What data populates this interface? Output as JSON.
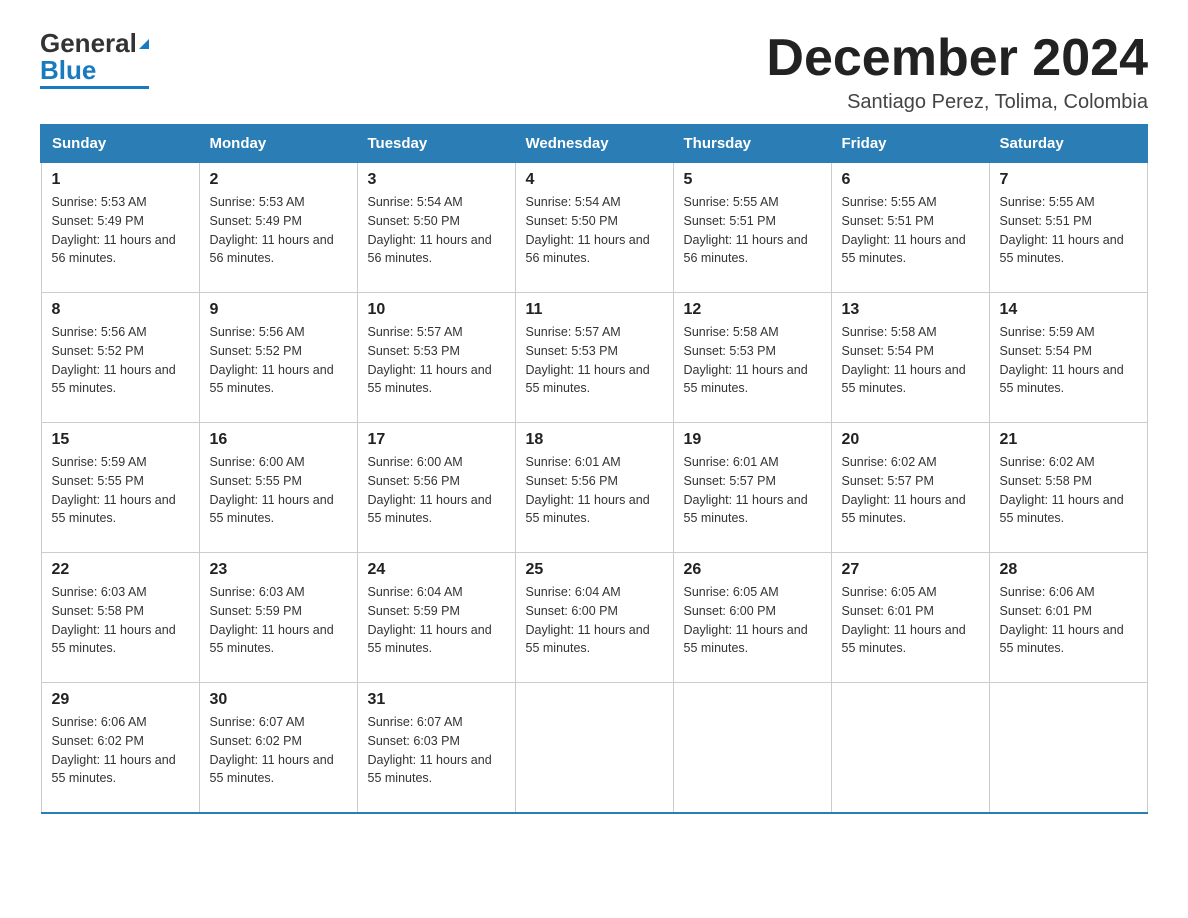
{
  "header": {
    "logo_general": "General",
    "logo_blue": "Blue",
    "month_title": "December 2024",
    "subtitle": "Santiago Perez, Tolima, Colombia"
  },
  "days_of_week": [
    "Sunday",
    "Monday",
    "Tuesday",
    "Wednesday",
    "Thursday",
    "Friday",
    "Saturday"
  ],
  "weeks": [
    [
      {
        "day": "1",
        "sunrise": "Sunrise: 5:53 AM",
        "sunset": "Sunset: 5:49 PM",
        "daylight": "Daylight: 11 hours and 56 minutes."
      },
      {
        "day": "2",
        "sunrise": "Sunrise: 5:53 AM",
        "sunset": "Sunset: 5:49 PM",
        "daylight": "Daylight: 11 hours and 56 minutes."
      },
      {
        "day": "3",
        "sunrise": "Sunrise: 5:54 AM",
        "sunset": "Sunset: 5:50 PM",
        "daylight": "Daylight: 11 hours and 56 minutes."
      },
      {
        "day": "4",
        "sunrise": "Sunrise: 5:54 AM",
        "sunset": "Sunset: 5:50 PM",
        "daylight": "Daylight: 11 hours and 56 minutes."
      },
      {
        "day": "5",
        "sunrise": "Sunrise: 5:55 AM",
        "sunset": "Sunset: 5:51 PM",
        "daylight": "Daylight: 11 hours and 56 minutes."
      },
      {
        "day": "6",
        "sunrise": "Sunrise: 5:55 AM",
        "sunset": "Sunset: 5:51 PM",
        "daylight": "Daylight: 11 hours and 55 minutes."
      },
      {
        "day": "7",
        "sunrise": "Sunrise: 5:55 AM",
        "sunset": "Sunset: 5:51 PM",
        "daylight": "Daylight: 11 hours and 55 minutes."
      }
    ],
    [
      {
        "day": "8",
        "sunrise": "Sunrise: 5:56 AM",
        "sunset": "Sunset: 5:52 PM",
        "daylight": "Daylight: 11 hours and 55 minutes."
      },
      {
        "day": "9",
        "sunrise": "Sunrise: 5:56 AM",
        "sunset": "Sunset: 5:52 PM",
        "daylight": "Daylight: 11 hours and 55 minutes."
      },
      {
        "day": "10",
        "sunrise": "Sunrise: 5:57 AM",
        "sunset": "Sunset: 5:53 PM",
        "daylight": "Daylight: 11 hours and 55 minutes."
      },
      {
        "day": "11",
        "sunrise": "Sunrise: 5:57 AM",
        "sunset": "Sunset: 5:53 PM",
        "daylight": "Daylight: 11 hours and 55 minutes."
      },
      {
        "day": "12",
        "sunrise": "Sunrise: 5:58 AM",
        "sunset": "Sunset: 5:53 PM",
        "daylight": "Daylight: 11 hours and 55 minutes."
      },
      {
        "day": "13",
        "sunrise": "Sunrise: 5:58 AM",
        "sunset": "Sunset: 5:54 PM",
        "daylight": "Daylight: 11 hours and 55 minutes."
      },
      {
        "day": "14",
        "sunrise": "Sunrise: 5:59 AM",
        "sunset": "Sunset: 5:54 PM",
        "daylight": "Daylight: 11 hours and 55 minutes."
      }
    ],
    [
      {
        "day": "15",
        "sunrise": "Sunrise: 5:59 AM",
        "sunset": "Sunset: 5:55 PM",
        "daylight": "Daylight: 11 hours and 55 minutes."
      },
      {
        "day": "16",
        "sunrise": "Sunrise: 6:00 AM",
        "sunset": "Sunset: 5:55 PM",
        "daylight": "Daylight: 11 hours and 55 minutes."
      },
      {
        "day": "17",
        "sunrise": "Sunrise: 6:00 AM",
        "sunset": "Sunset: 5:56 PM",
        "daylight": "Daylight: 11 hours and 55 minutes."
      },
      {
        "day": "18",
        "sunrise": "Sunrise: 6:01 AM",
        "sunset": "Sunset: 5:56 PM",
        "daylight": "Daylight: 11 hours and 55 minutes."
      },
      {
        "day": "19",
        "sunrise": "Sunrise: 6:01 AM",
        "sunset": "Sunset: 5:57 PM",
        "daylight": "Daylight: 11 hours and 55 minutes."
      },
      {
        "day": "20",
        "sunrise": "Sunrise: 6:02 AM",
        "sunset": "Sunset: 5:57 PM",
        "daylight": "Daylight: 11 hours and 55 minutes."
      },
      {
        "day": "21",
        "sunrise": "Sunrise: 6:02 AM",
        "sunset": "Sunset: 5:58 PM",
        "daylight": "Daylight: 11 hours and 55 minutes."
      }
    ],
    [
      {
        "day": "22",
        "sunrise": "Sunrise: 6:03 AM",
        "sunset": "Sunset: 5:58 PM",
        "daylight": "Daylight: 11 hours and 55 minutes."
      },
      {
        "day": "23",
        "sunrise": "Sunrise: 6:03 AM",
        "sunset": "Sunset: 5:59 PM",
        "daylight": "Daylight: 11 hours and 55 minutes."
      },
      {
        "day": "24",
        "sunrise": "Sunrise: 6:04 AM",
        "sunset": "Sunset: 5:59 PM",
        "daylight": "Daylight: 11 hours and 55 minutes."
      },
      {
        "day": "25",
        "sunrise": "Sunrise: 6:04 AM",
        "sunset": "Sunset: 6:00 PM",
        "daylight": "Daylight: 11 hours and 55 minutes."
      },
      {
        "day": "26",
        "sunrise": "Sunrise: 6:05 AM",
        "sunset": "Sunset: 6:00 PM",
        "daylight": "Daylight: 11 hours and 55 minutes."
      },
      {
        "day": "27",
        "sunrise": "Sunrise: 6:05 AM",
        "sunset": "Sunset: 6:01 PM",
        "daylight": "Daylight: 11 hours and 55 minutes."
      },
      {
        "day": "28",
        "sunrise": "Sunrise: 6:06 AM",
        "sunset": "Sunset: 6:01 PM",
        "daylight": "Daylight: 11 hours and 55 minutes."
      }
    ],
    [
      {
        "day": "29",
        "sunrise": "Sunrise: 6:06 AM",
        "sunset": "Sunset: 6:02 PM",
        "daylight": "Daylight: 11 hours and 55 minutes."
      },
      {
        "day": "30",
        "sunrise": "Sunrise: 6:07 AM",
        "sunset": "Sunset: 6:02 PM",
        "daylight": "Daylight: 11 hours and 55 minutes."
      },
      {
        "day": "31",
        "sunrise": "Sunrise: 6:07 AM",
        "sunset": "Sunset: 6:03 PM",
        "daylight": "Daylight: 11 hours and 55 minutes."
      },
      null,
      null,
      null,
      null
    ]
  ]
}
